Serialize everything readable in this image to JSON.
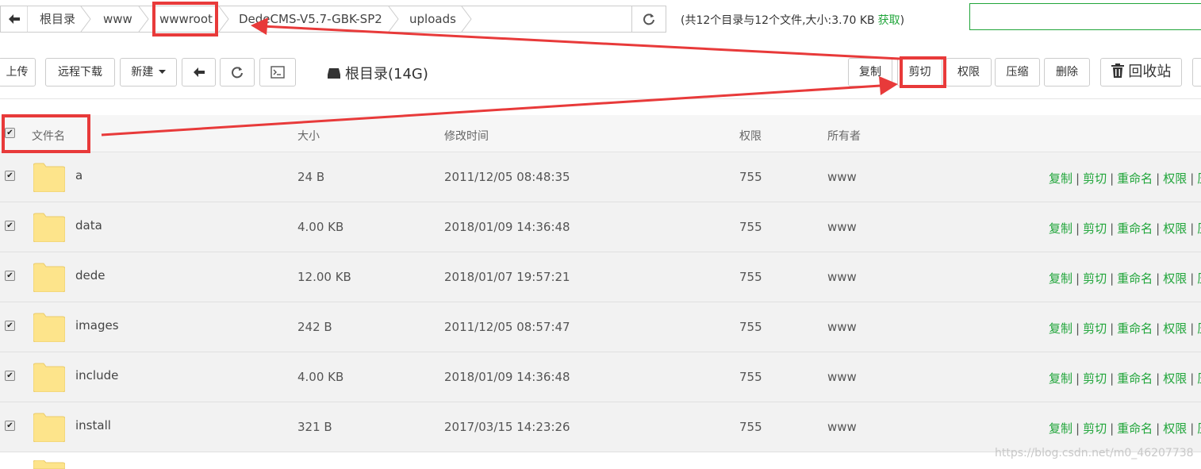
{
  "breadcrumb": {
    "items": [
      "根目录",
      "www",
      "wwwroot",
      "DedeCMS-V5.7-GBK-SP2",
      "uploads"
    ]
  },
  "summary": {
    "text": "(共12个目录与12个文件,大小:3.70 KB",
    "get_label": "获取",
    "close": ")"
  },
  "search": {
    "placeholder": ""
  },
  "toolbar": {
    "upload": "上传",
    "remote_download": "远程下载",
    "new": "新建",
    "disk": "根目录(14G)",
    "copy": "复制",
    "cut": "剪切",
    "permission": "权限",
    "compress": "压缩",
    "delete": "删除",
    "recycle": "回收站"
  },
  "table": {
    "headers": {
      "name": "文件名",
      "size": "大小",
      "mtime": "修改时间",
      "perm": "权限",
      "owner": "所有者"
    },
    "rows": [
      {
        "name": "a",
        "size": "24 B",
        "mtime": "2011/12/05 08:48:35",
        "perm": "755",
        "owner": "www",
        "checked": true
      },
      {
        "name": "data",
        "size": "4.00 KB",
        "mtime": "2018/01/09 14:36:48",
        "perm": "755",
        "owner": "www",
        "checked": true
      },
      {
        "name": "dede",
        "size": "12.00 KB",
        "mtime": "2018/01/07 19:57:21",
        "perm": "755",
        "owner": "www",
        "checked": true
      },
      {
        "name": "images",
        "size": "242 B",
        "mtime": "2011/12/05 08:57:47",
        "perm": "755",
        "owner": "www",
        "checked": true
      },
      {
        "name": "include",
        "size": "4.00 KB",
        "mtime": "2018/01/09 14:36:48",
        "perm": "755",
        "owner": "www",
        "checked": true
      },
      {
        "name": "install",
        "size": "321 B",
        "mtime": "2017/03/15 14:23:26",
        "perm": "755",
        "owner": "www",
        "checked": true
      }
    ],
    "row_ops": {
      "copy": "复制",
      "cut": "剪切",
      "rename": "重命名",
      "perm": "权限",
      "more": "压"
    }
  },
  "watermark": "https://blog.csdn.net/m0_46207738",
  "colors": {
    "accent": "#20a53a",
    "highlight": "#e83a3a",
    "folder": "#fde48b"
  }
}
